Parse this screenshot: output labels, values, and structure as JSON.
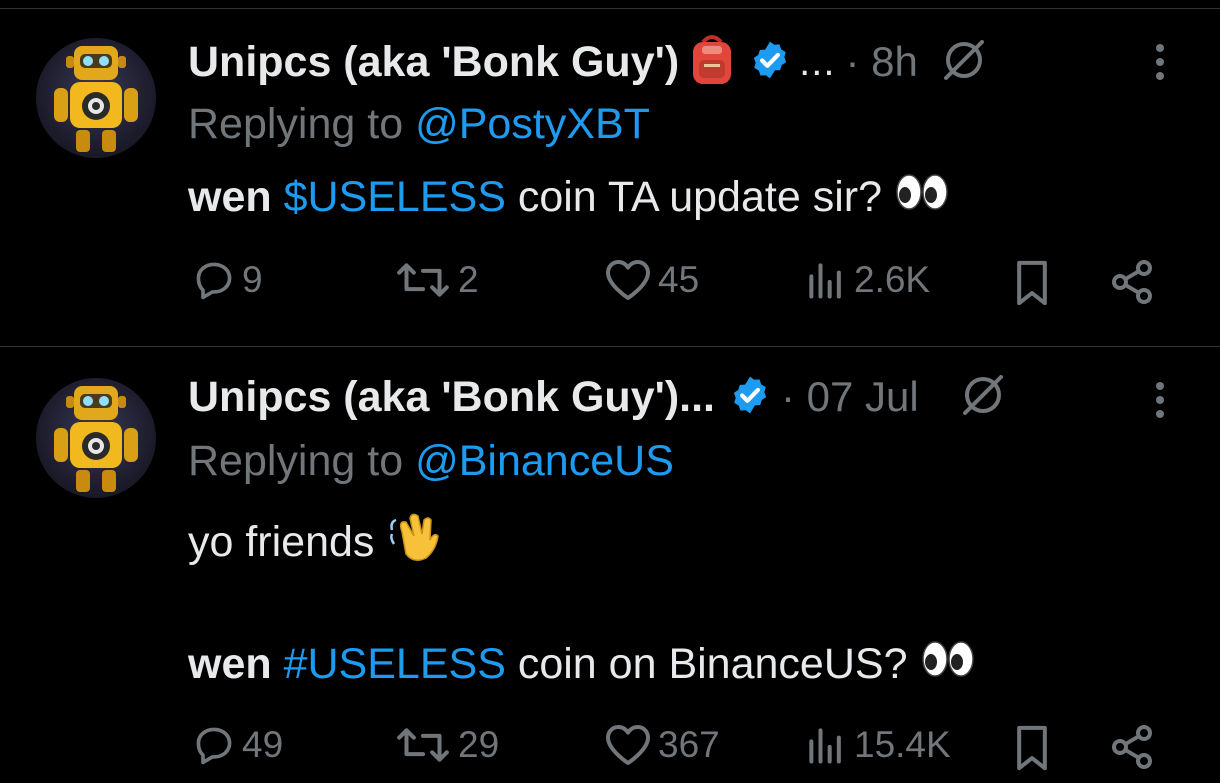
{
  "tweets": [
    {
      "display_name": "Unipcs (aka 'Bonk Guy')",
      "name_overflow": "...",
      "time": "· 8h",
      "replying_prefix": "Replying to",
      "replying_handle": "@PostyXBT",
      "body": {
        "prefix": "wen",
        "tag": "$USELESS",
        "rest": "coin TA update sir?"
      },
      "stats": {
        "replies": "9",
        "reposts": "2",
        "likes": "45",
        "views": "2.6K"
      }
    },
    {
      "display_name": "Unipcs (aka 'Bonk Guy')...",
      "time": "· 07 Jul",
      "replying_prefix": "Replying to",
      "replying_handle": "@BinanceUS",
      "body_line1": "yo friends",
      "body_line2": {
        "prefix": "wen",
        "tag": "#USELESS",
        "rest": "coin on BinanceUS?"
      },
      "stats": {
        "replies": "49",
        "reposts": "29",
        "likes": "367",
        "views": "15.4K"
      }
    }
  ],
  "icons": {
    "avatar": "robot-avatar-icon",
    "name_emoji": "backpack-emoji-icon",
    "verified": "verified-badge-icon",
    "grok": "grok-icon",
    "more": "more-options-icon",
    "eyes": "eyes-emoji-icon",
    "wave": "waving-hand-emoji-icon",
    "reply": "reply-icon",
    "repost": "repost-icon",
    "like": "like-icon",
    "views": "views-icon",
    "bookmark": "bookmark-icon",
    "share": "share-icon"
  },
  "colors": {
    "background": "#000000",
    "text": "#e7e9ea",
    "muted": "#71767b",
    "accent": "#1d9bf0",
    "divider": "#2f3336"
  }
}
